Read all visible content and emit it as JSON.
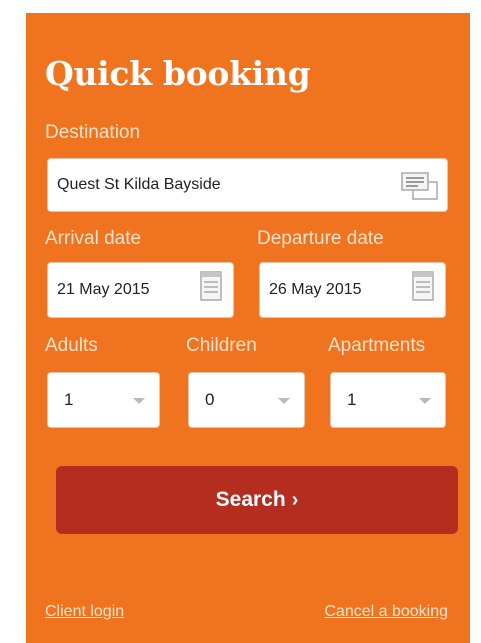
{
  "booking": {
    "title": "Quick booking",
    "destination": {
      "label": "Destination",
      "value": "Quest St Kilda Bayside"
    },
    "arrival": {
      "label": "Arrival date",
      "value": "21 May 2015"
    },
    "departure": {
      "label": "Departure date",
      "value": "26 May 2015"
    },
    "adults": {
      "label": "Adults",
      "value": "1"
    },
    "children": {
      "label": "Children",
      "value": "0"
    },
    "apartments": {
      "label": "Apartments",
      "value": "1"
    },
    "search_label": "Search",
    "search_chevron": "›",
    "client_login": "Client login",
    "cancel_booking": "Cancel a booking"
  },
  "colors": {
    "panel_bg": "#f0731f",
    "button_bg": "#b42d1e",
    "label": "#fde3cc"
  },
  "icons": [
    "list-icon",
    "calendar-icon",
    "chevron-down-icon",
    "chevron-right-icon"
  ]
}
